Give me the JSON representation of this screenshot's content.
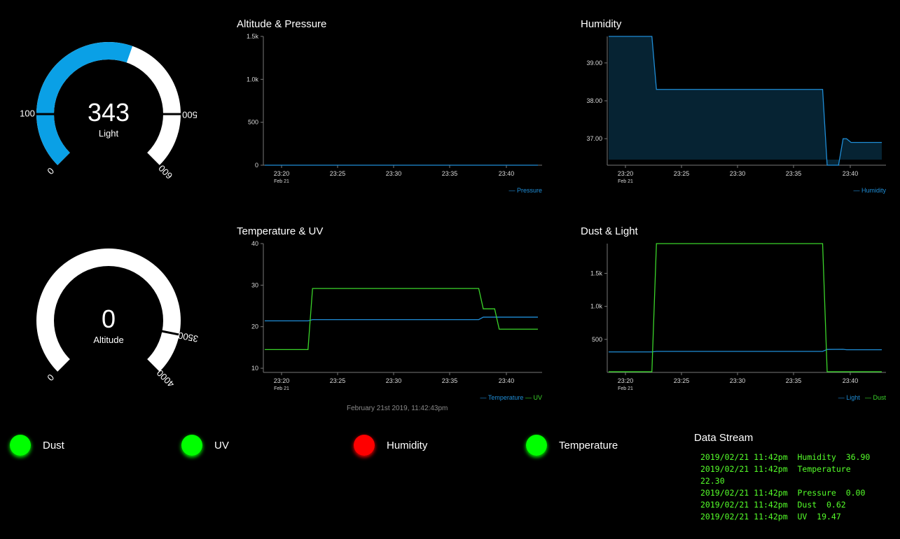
{
  "gauges": [
    {
      "id": "light",
      "value": "343",
      "label": "Light",
      "min": 0,
      "max": 600,
      "threshold": 500,
      "min_label": "0",
      "max_label": "600",
      "threshold_label": "500",
      "mark_label": "100"
    },
    {
      "id": "altitude",
      "value": "0",
      "label": "Altitude",
      "min": 0,
      "max": 4000,
      "threshold": 3500,
      "min_label": "0",
      "max_label": "4000",
      "threshold_label": "3500"
    }
  ],
  "colors": {
    "blue": "#1f8dd6",
    "green": "#3bd42a",
    "gauge_fill": "#0aa0e6",
    "led_green": "#00ff00",
    "led_red": "#ff0000"
  },
  "charts": {
    "altitude_pressure": {
      "title": "Altitude & Pressure",
      "chart_data": {
        "type": "line",
        "x": [
          "23:19",
          "23:43"
        ],
        "x_ticks": [
          "23:20",
          "23:25",
          "23:30",
          "23:35",
          "23:40"
        ],
        "x_sub": "Feb 21",
        "y_ticks": [
          "0",
          "500",
          "1.0k",
          "1.5k"
        ],
        "ylim": [
          0,
          1500
        ],
        "series": [
          {
            "name": "Pressure",
            "color": "#1f8dd6",
            "points": [
              [
                0,
                0
              ],
              [
                24,
                0
              ]
            ]
          }
        ]
      }
    },
    "humidity": {
      "title": "Humidity",
      "chart_data": {
        "type": "area",
        "x_ticks": [
          "23:20",
          "23:25",
          "23:30",
          "23:35",
          "23:40"
        ],
        "x_sub": "Feb 21",
        "y_ticks": [
          "37.00",
          "38.00",
          "39.00"
        ],
        "ylim": [
          36.3,
          39.7
        ],
        "series": [
          {
            "name": "Humidity",
            "color": "#1f8dd6",
            "points": [
              [
                0,
                39.7
              ],
              [
                3.8,
                39.7
              ],
              [
                4.2,
                38.3
              ],
              [
                18.8,
                38.3
              ],
              [
                19.2,
                36.3
              ],
              [
                20.2,
                36.3
              ],
              [
                20.6,
                37.0
              ],
              [
                20.9,
                37.0
              ],
              [
                21.3,
                36.9
              ],
              [
                24,
                36.9
              ]
            ]
          }
        ]
      }
    },
    "temperature_uv": {
      "title": "Temperature & UV",
      "chart_data": {
        "type": "line",
        "x_ticks": [
          "23:20",
          "23:25",
          "23:30",
          "23:35",
          "23:40"
        ],
        "x_sub": "Feb 21",
        "y_ticks": [
          "10",
          "20",
          "30",
          "40"
        ],
        "ylim": [
          9,
          40
        ],
        "series": [
          {
            "name": "Temperature",
            "color": "#1f8dd6",
            "points": [
              [
                0,
                21.4
              ],
              [
                3.8,
                21.4
              ],
              [
                4.2,
                21.7
              ],
              [
                18.8,
                21.7
              ],
              [
                19.2,
                22.3
              ],
              [
                24,
                22.3
              ]
            ]
          },
          {
            "name": "UV",
            "color": "#3bd42a",
            "points": [
              [
                0,
                14.5
              ],
              [
                3.8,
                14.5
              ],
              [
                4.2,
                29.2
              ],
              [
                18.8,
                29.2
              ],
              [
                19.2,
                24.3
              ],
              [
                20.2,
                24.3
              ],
              [
                20.6,
                19.4
              ],
              [
                24,
                19.4
              ]
            ]
          }
        ]
      }
    },
    "dust_light": {
      "title": "Dust & Light",
      "chart_data": {
        "type": "line",
        "x_ticks": [
          "23:20",
          "23:25",
          "23:30",
          "23:35",
          "23:40"
        ],
        "x_sub": "Feb 21",
        "y_ticks": [
          "500",
          "1.0k",
          "1.5k"
        ],
        "ylim": [
          0,
          1950
        ],
        "series": [
          {
            "name": "Light",
            "color": "#1f8dd6",
            "points": [
              [
                0,
                310
              ],
              [
                3.8,
                310
              ],
              [
                4.2,
                318
              ],
              [
                18.8,
                318
              ],
              [
                19.2,
                348
              ],
              [
                20.6,
                350
              ],
              [
                20.9,
                343
              ],
              [
                24,
                343
              ]
            ]
          },
          {
            "name": "Dust",
            "color": "#3bd42a",
            "points": [
              [
                0,
                10
              ],
              [
                3.8,
                10
              ],
              [
                4.2,
                1950
              ],
              [
                18.8,
                1950
              ],
              [
                19.2,
                10
              ],
              [
                24,
                10
              ]
            ]
          }
        ]
      }
    }
  },
  "timestamp": "February 21st 2019, 11:42:43pm",
  "statuses": [
    {
      "label": "Dust",
      "state": "ok"
    },
    {
      "label": "UV",
      "state": "ok"
    },
    {
      "label": "Humidity",
      "state": "alert"
    },
    {
      "label": "Temperature",
      "state": "ok"
    }
  ],
  "data_stream": {
    "title": "Data Stream",
    "lines": [
      "2019/02/21 11:42pm  Humidity  36.90",
      "2019/02/21 11:42pm  Temperature  22.30",
      "2019/02/21 11:42pm  Pressure  0.00",
      "2019/02/21 11:42pm  Dust  0.62",
      "2019/02/21 11:42pm  UV  19.47"
    ]
  }
}
